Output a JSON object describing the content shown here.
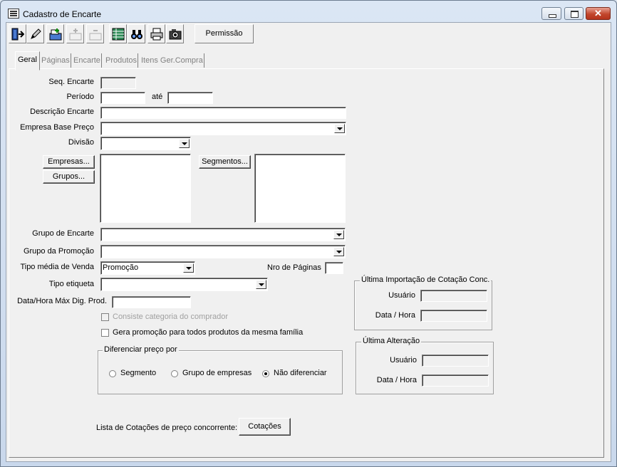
{
  "window": {
    "title": "Cadastro de Encarte"
  },
  "toolbar": {
    "permissao_label": "Permissão"
  },
  "tabs": [
    {
      "label": "Geral"
    },
    {
      "label": "Páginas"
    },
    {
      "label": "Encarte"
    },
    {
      "label": "Produtos"
    },
    {
      "label": "Itens Ger.Compra"
    }
  ],
  "form": {
    "seq_encarte_label": "Seq. Encarte",
    "periodo_label": "Período",
    "ate_label": "até",
    "descricao_label": "Descrição Encarte",
    "empresa_base_label": "Empresa Base Preço",
    "divisao_label": "Divisão",
    "empresas_button": "Empresas...",
    "grupos_button": "Grupos...",
    "segmentos_button": "Segmentos...",
    "grupo_encarte_label": "Grupo de Encarte",
    "grupo_promocao_label": "Grupo da Promoção",
    "tipo_midia_label": "Tipo média de Venda",
    "tipo_midia_value": "Promoção",
    "nro_paginas_label": "Nro de Páginas",
    "tipo_etiqueta_label": "Tipo etiqueta",
    "data_hora_max_label": "Data/Hora Máx Dig. Prod.",
    "consiste_label": "Consiste categoria do comprador",
    "gera_promocao_label": "Gera promoção para todos produtos da mesma família",
    "diferenciar_title": "Diferenciar preço por",
    "radio_segmento": "Segmento",
    "radio_grupo": "Grupo de empresas",
    "radio_nao": "Não diferenciar",
    "lista_cotacoes_label": "Lista de Cotações de preço concorrente:",
    "cotacoes_button": "Cotações"
  },
  "ultima_importacao": {
    "title": "Última Importação de Cotação Conc.",
    "usuario_label": "Usuário",
    "data_hora_label": "Data / Hora"
  },
  "ultima_alteracao": {
    "title": "Última Alteração",
    "usuario_label": "Usuário",
    "data_hora_label": "Data / Hora"
  }
}
